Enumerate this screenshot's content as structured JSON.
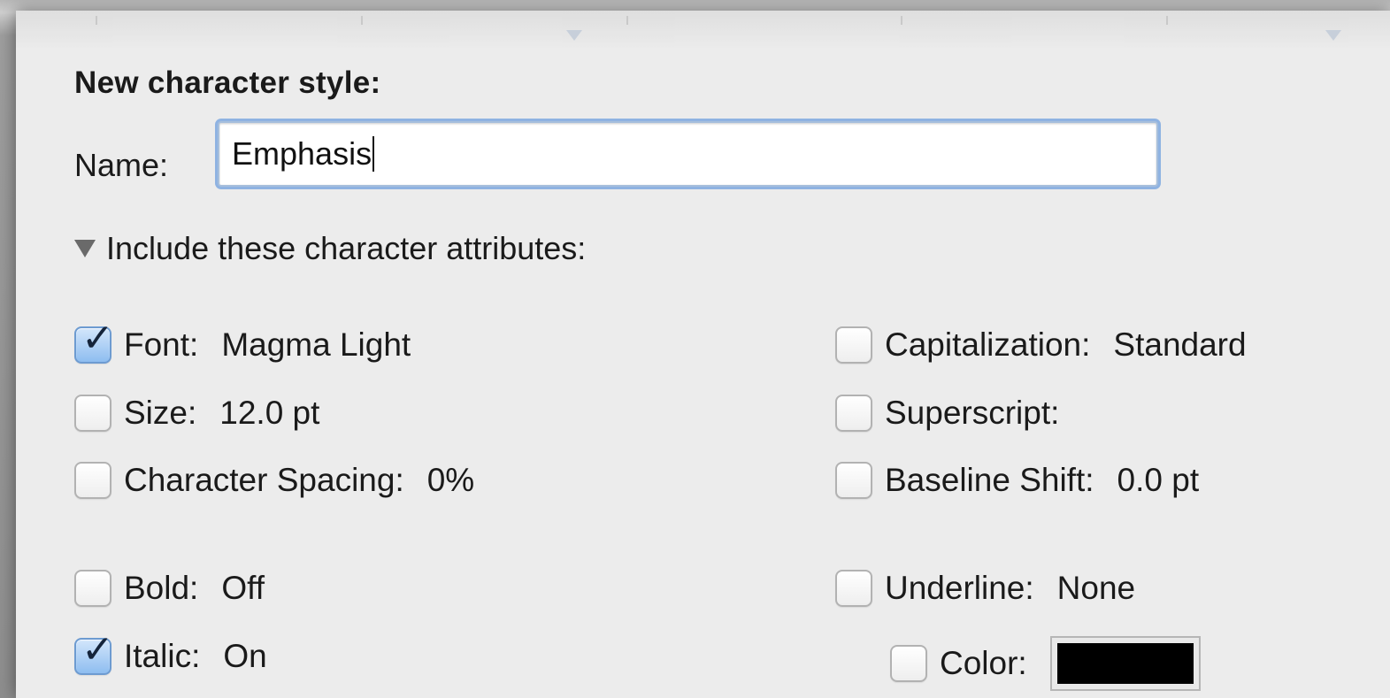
{
  "dialog": {
    "heading": "New character style:",
    "name_label": "Name:",
    "name_value": "Emphasis",
    "disclosure_label": "Include these character attributes:"
  },
  "attributes_left": [
    {
      "label": "Font:",
      "value": "Magma Light",
      "checked": true
    },
    {
      "label": "Size:",
      "value": "12.0 pt",
      "checked": false
    },
    {
      "label": "Character Spacing:",
      "value": "0%",
      "checked": false
    },
    {
      "label": "Bold:",
      "value": "Off",
      "checked": false
    },
    {
      "label": "Italic:",
      "value": "On",
      "checked": true
    }
  ],
  "attributes_right": [
    {
      "label": "Capitalization:",
      "value": "Standard",
      "checked": false
    },
    {
      "label": "Superscript:",
      "value": "",
      "checked": false
    },
    {
      "label": "Baseline Shift:",
      "value": "0.0 pt",
      "checked": false
    },
    {
      "label": "Underline:",
      "value": "None",
      "checked": false
    },
    {
      "label": "Color:",
      "value": "",
      "checked": false,
      "color": "#000000"
    }
  ],
  "colors": {
    "focus_ring": "#8fb3e2",
    "checkbox_checked": "#8ebdf0",
    "panel_bg": "#ececec"
  }
}
